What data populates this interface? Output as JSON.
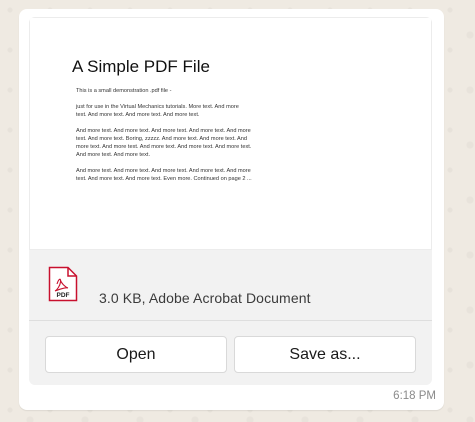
{
  "message": {
    "time": "6:18 PM",
    "attachment": {
      "file_meta": "3.0 KB, Adobe Acrobat Document",
      "icon": "pdf-file-icon",
      "icon_label": "PDF",
      "accent_color": "#c8102e",
      "preview": {
        "title": "A Simple PDF File",
        "lines": [
          "This is a small demonstration .pdf file -",
          "just for use in the Virtual Mechanics tutorials. More text. And more",
          "text. And more text. And more text. And more text.",
          "And more text. And more text. And more text. And more text. And more",
          "text. And more text. Boring, zzzzz. And more text. And more text. And",
          "more text. And more text. And more text. And more text. And more text.",
          "And more text. And more text.",
          "And more text. And more text. And more text. And more text. And more",
          "text. And more text. And more text. Even more. Continued on page 2 ..."
        ]
      }
    },
    "buttons": {
      "open": "Open",
      "save_as": "Save as..."
    }
  }
}
